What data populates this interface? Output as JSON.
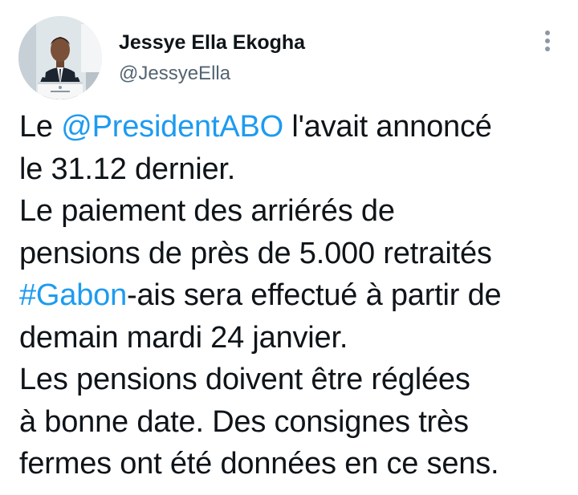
{
  "author": {
    "display_name": "Jessye Ella Ekogha",
    "handle": "@JessyeElla",
    "avatar_icon": "profile-photo-speaker-at-podium"
  },
  "menu": {
    "icon": "more-vertical-icon"
  },
  "tweet": {
    "lines": [
      {
        "before": "Le ",
        "link": "@PresidentABO",
        "after": " l'avait annoncé"
      },
      {
        "text": "le 31.12 dernier."
      },
      {
        "text": "Le paiement des arriérés de"
      },
      {
        "text": "pensions de près de 5.000 retraités"
      },
      {
        "link": "#Gabon",
        "after": "-ais sera effectué à partir de"
      },
      {
        "text": "demain mardi 24 janvier."
      },
      {
        "text": "Les pensions doivent être réglées"
      },
      {
        "text": "à bonne date. Des consignes très"
      },
      {
        "text": "fermes ont été données en ce sens."
      }
    ]
  },
  "colors": {
    "link": "#1d9bf0",
    "text": "#0f1419",
    "secondary": "#536471",
    "background": "#ffffff"
  }
}
